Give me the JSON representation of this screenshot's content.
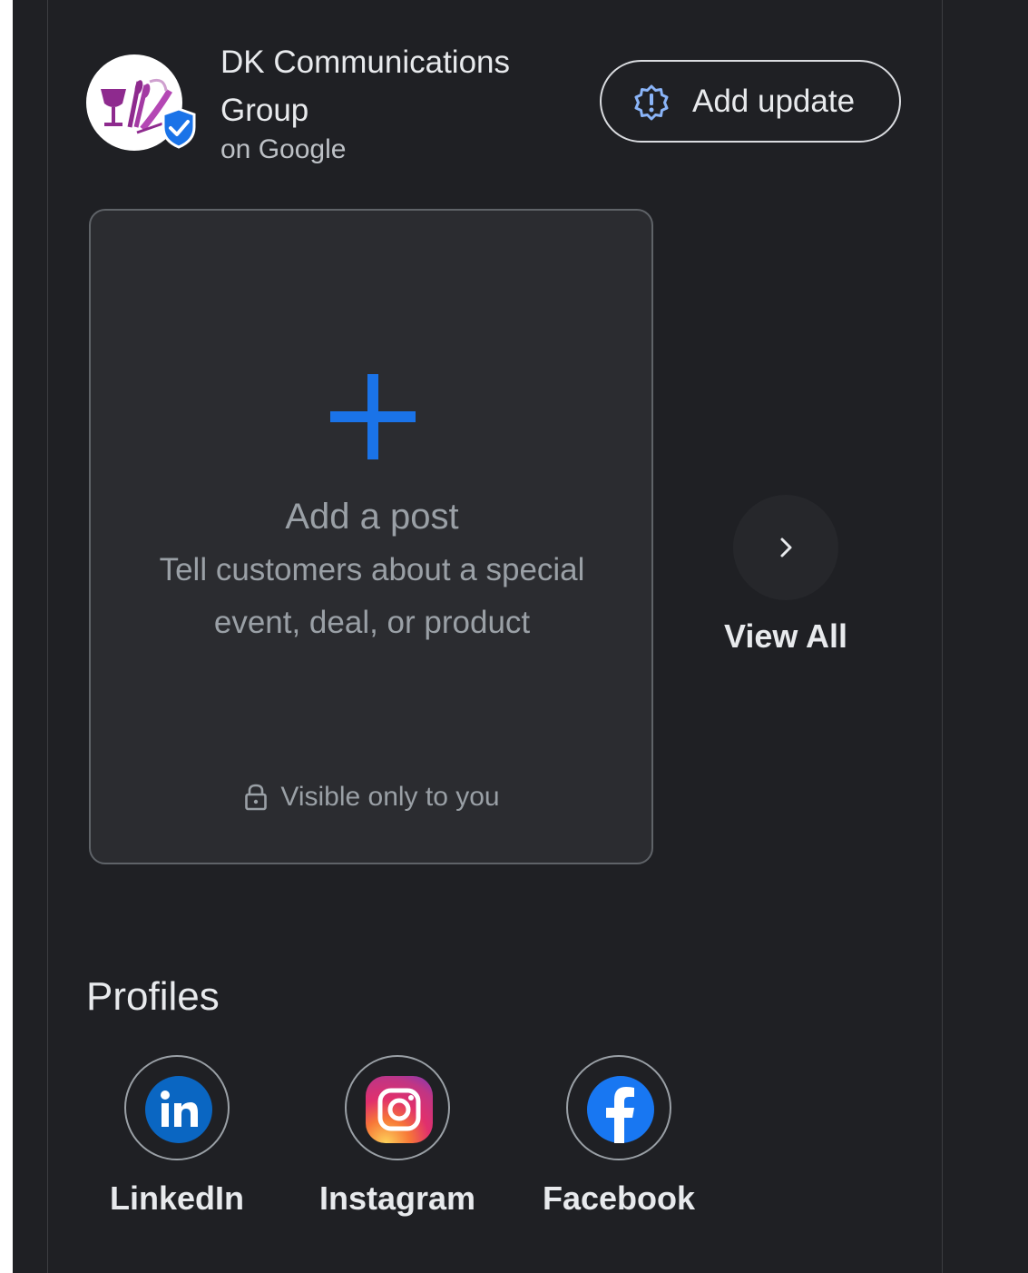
{
  "header": {
    "business_name": "DK Communications Group",
    "subtitle": "on Google",
    "add_update_label": "Add update"
  },
  "post_card": {
    "title": "Add a post",
    "description": "Tell customers about a special event, deal, or product",
    "visibility": "Visible only to you"
  },
  "view_all": {
    "label": "View All"
  },
  "profiles": {
    "title": "Profiles",
    "items": [
      {
        "label": "LinkedIn",
        "icon": "linkedin-icon"
      },
      {
        "label": "Instagram",
        "icon": "instagram-icon"
      },
      {
        "label": "Facebook",
        "icon": "facebook-icon"
      }
    ]
  },
  "colors": {
    "background": "#1f2024",
    "accent_blue": "#1a73e8",
    "text_primary": "#e8eaed",
    "text_secondary": "#9aa0a6",
    "linkedin": "#0a66c2",
    "facebook": "#1877f2",
    "logo_purple": "#8e2a8e"
  }
}
